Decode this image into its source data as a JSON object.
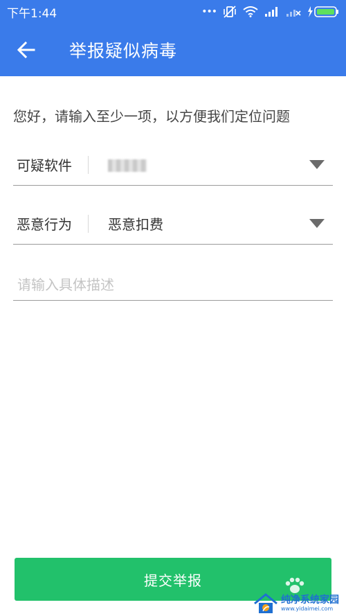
{
  "status_bar": {
    "time": "下午1:44",
    "dots": "•••"
  },
  "app_bar": {
    "title": "举报疑似病毒"
  },
  "form": {
    "intro": "您好，请输入至少一项，以方便我们定位问题",
    "suspicious_software": {
      "label": "可疑软件"
    },
    "malicious_behavior": {
      "label": "恶意行为",
      "value": "恶意扣费"
    },
    "description": {
      "placeholder": "请输入具体描述",
      "value": ""
    }
  },
  "submit": {
    "label": "提交举报"
  },
  "watermark": {
    "name": "纯净系统家园",
    "url": "www.yidaimei.com"
  },
  "colors": {
    "primary": "#3a7bea",
    "accent": "#22c16b"
  }
}
